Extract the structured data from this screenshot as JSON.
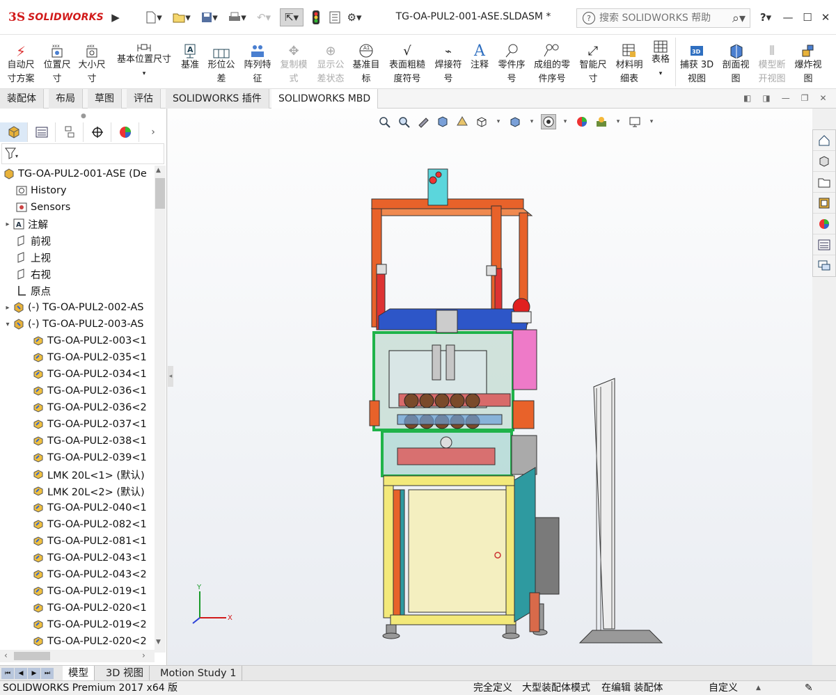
{
  "app": {
    "brand": "SOLIDWORKS",
    "doc_title": "TG-OA-PUL2-001-ASE.SLDASM *"
  },
  "search": {
    "placeholder": "搜索 SOLIDWORKS 帮助"
  },
  "window_controls": {
    "help": "?",
    "minimize": "—",
    "maximize": "☐",
    "close": "✕"
  },
  "ribbon": {
    "buttons": [
      {
        "label1": "自动尺",
        "label2": "寸方案"
      },
      {
        "label1": "位置尺",
        "label2": "寸"
      },
      {
        "label1": "大小尺",
        "label2": "寸"
      },
      {
        "label1": "基本位置尺寸",
        "label2": "▾"
      },
      {
        "label1": "基准",
        "label2": ""
      },
      {
        "label1": "形位公",
        "label2": "差"
      },
      {
        "label1": "阵列特",
        "label2": "征"
      },
      {
        "label1": "复制模",
        "label2": "式"
      },
      {
        "label1": "显示公",
        "label2": "差状态"
      },
      {
        "label1": "基准目",
        "label2": "标"
      },
      {
        "label1": "表面粗糙",
        "label2": "度符号"
      },
      {
        "label1": "焊接符",
        "label2": "号"
      },
      {
        "label1": "注释",
        "label2": ""
      },
      {
        "label1": "零件序",
        "label2": "号"
      },
      {
        "label1": "成组的零",
        "label2": "件序号"
      },
      {
        "label1": "智能尺",
        "label2": "寸"
      },
      {
        "label1": "材料明",
        "label2": "细表"
      },
      {
        "label1": "表格",
        "label2": "▾"
      },
      {
        "label1": "捕获 3D",
        "label2": "视图"
      },
      {
        "label1": "剖面视",
        "label2": "图"
      },
      {
        "label1": "模型断",
        "label2": "开视图"
      },
      {
        "label1": "爆炸视",
        "label2": "图"
      }
    ]
  },
  "command_tabs": [
    "装配体",
    "布局",
    "草图",
    "评估",
    "SOLIDWORKS 插件",
    "SOLIDWORKS MBD"
  ],
  "tree": {
    "root": "TG-OA-PUL2-001-ASE  (De",
    "items": [
      "History",
      "Sensors",
      "注解",
      "前视",
      "上视",
      "右视",
      "原点",
      "(-) TG-OA-PUL2-002-AS",
      "(-) TG-OA-PUL2-003-AS",
      "TG-OA-PUL2-003<1",
      "TG-OA-PUL2-035<1",
      "TG-OA-PUL2-034<1",
      "TG-OA-PUL2-036<1",
      "TG-OA-PUL2-036<2",
      "TG-OA-PUL2-037<1",
      "TG-OA-PUL2-038<1",
      "TG-OA-PUL2-039<1",
      "LMK 20L<1> (默认)",
      "LMK 20L<2> (默认)",
      "TG-OA-PUL2-040<1",
      "TG-OA-PUL2-082<1",
      "TG-OA-PUL2-081<1",
      "TG-OA-PUL2-043<1",
      "TG-OA-PUL2-043<2",
      "TG-OA-PUL2-019<1",
      "TG-OA-PUL2-020<1",
      "TG-OA-PUL2-019<2",
      "TG-OA-PUL2-020<2"
    ]
  },
  "axes": {
    "x": "X",
    "y": "Y"
  },
  "bottom_tabs": [
    "模型",
    "3D 视图",
    "Motion Study 1"
  ],
  "status": {
    "product": "SOLIDWORKS Premium 2017 x64 版",
    "define": "完全定义",
    "mode": "大型装配体模式",
    "editing": "在编辑 装配体",
    "custom": "自定义"
  },
  "colors": {
    "brand_red": "#d11a1a",
    "frame_orange": "#e8622a",
    "accent_blue": "#2f6fc0"
  }
}
